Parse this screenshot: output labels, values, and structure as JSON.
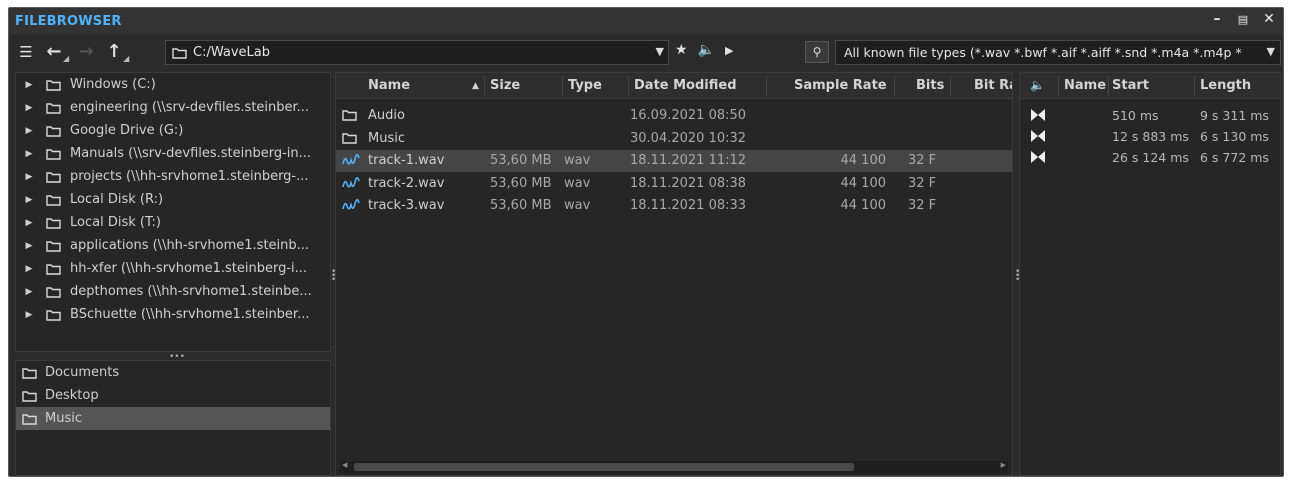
{
  "window": {
    "title": "FILEBROWSER",
    "controls": [
      "minimize-icon",
      "layout-icon",
      "close-icon"
    ]
  },
  "toolbar": {
    "path": "C:/WaveLab",
    "filter": "All known file types (*.wav *.bwf *.aif *.aiff *.snd *.m4a *.m4p *"
  },
  "tree": {
    "items": [
      {
        "label": "Windows (C:)"
      },
      {
        "label": "engineering (\\\\srv-devfiles.steinber..."
      },
      {
        "label": "Google Drive (G:)"
      },
      {
        "label": "Manuals (\\\\srv-devfiles.steinberg-in..."
      },
      {
        "label": "projects (\\\\hh-srvhome1.steinberg-..."
      },
      {
        "label": "Local Disk (R:)"
      },
      {
        "label": "Local Disk (T:)"
      },
      {
        "label": "applications (\\\\hh-srvhome1.steinb..."
      },
      {
        "label": "hh-xfer (\\\\hh-srvhome1.steinberg-i..."
      },
      {
        "label": "depthomes (\\\\hh-srvhome1.steinbe..."
      },
      {
        "label": "BSchuette (\\\\hh-srvhome1.steinber..."
      }
    ]
  },
  "favorites": {
    "items": [
      {
        "label": "Documents",
        "selected": false
      },
      {
        "label": "Desktop",
        "selected": false
      },
      {
        "label": "Music",
        "selected": true
      }
    ]
  },
  "files": {
    "columns": {
      "name": "Name",
      "size": "Size",
      "type": "Type",
      "date": "Date Modified",
      "rate": "Sample Rate",
      "bits": "Bits",
      "bitrate": "Bit Ra"
    },
    "rows": [
      {
        "icon": "folder-icon",
        "name": "Audio",
        "size": "",
        "type": "",
        "date": "16.09.2021 08:50",
        "rate": "",
        "bits": "",
        "selected": false
      },
      {
        "icon": "folder-icon",
        "name": "Music",
        "size": "",
        "type": "",
        "date": "30.04.2020 10:32",
        "rate": "",
        "bits": "",
        "selected": false
      },
      {
        "icon": "waveform-icon",
        "name": "track-1.wav",
        "size": "53,60 MB",
        "type": "wav",
        "date": "18.11.2021 11:12",
        "rate": "44 100",
        "bits": "32 F",
        "selected": true
      },
      {
        "icon": "waveform-icon",
        "name": "track-2.wav",
        "size": "53,60 MB",
        "type": "wav",
        "date": "18.11.2021 08:38",
        "rate": "44 100",
        "bits": "32 F",
        "selected": false
      },
      {
        "icon": "waveform-icon",
        "name": "track-3.wav",
        "size": "53,60 MB",
        "type": "wav",
        "date": "18.11.2021 08:33",
        "rate": "44 100",
        "bits": "32 F",
        "selected": false
      }
    ]
  },
  "markers": {
    "columns": {
      "name": "Name",
      "start": "Start",
      "length": "Length"
    },
    "rows": [
      {
        "start": "510 ms",
        "length": "9 s 311 ms"
      },
      {
        "start": "12 s 883 ms",
        "length": "6 s 130 ms"
      },
      {
        "start": "26 s 124 ms",
        "length": "6 s 772 ms"
      }
    ]
  },
  "colors": {
    "title": "#4fb3ff",
    "accent_wave": "#4fb3ff",
    "panel_bg": "#2b2b2b",
    "list_bg": "#262626",
    "selected_row": "#454545"
  }
}
